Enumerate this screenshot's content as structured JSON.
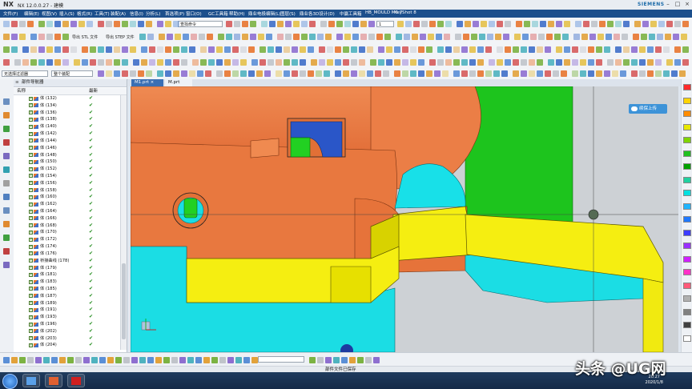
{
  "window": {
    "logo": "NX",
    "title": "NX 12.0.0.27 - 建模",
    "brand": "SIEMENS"
  },
  "menu": [
    "文件(F)",
    "编辑(E)",
    "视图(V)",
    "插入(S)",
    "格式(R)",
    "工具(T)",
    "装配(A)",
    "信息(I)",
    "分析(L)",
    "首选项(P)",
    "窗口(O)",
    "GC工具箱",
    "帮助(H)",
    "鼎业电极编辑(L)",
    "图层(S)",
    "鼎业各3D设计(D)",
    "中赢工具箱",
    "HB_MOULD M6.7",
    "KeyShot 8"
  ],
  "toolbar": {
    "command_search": "查找命令",
    "count_value": "1",
    "export_stl": "导出 STL 文件",
    "export_step": "导出 STEP 文件",
    "filter_label": "无选择过滤器",
    "assembly_scope": "整个装配"
  },
  "navigator": {
    "title": "部件导航器",
    "col_name": "名称",
    "col_latest": "最新",
    "rows": [
      "体 (132)",
      "体 (134)",
      "体 (136)",
      "体 (138)",
      "体 (140)",
      "体 (142)",
      "体 (144)",
      "体 (146)",
      "体 (148)",
      "体 (150)",
      "体 (152)",
      "体 (154)",
      "体 (156)",
      "体 (158)",
      "体 (160)",
      "体 (162)",
      "体 (164)",
      "体 (166)",
      "体 (168)",
      "体 (170)",
      "体 (172)",
      "体 (174)",
      "体 (176)",
      "桥接曲线 (178)",
      "体 (179)",
      "体 (181)",
      "体 (183)",
      "体 (185)",
      "体 (187)",
      "体 (189)",
      "体 (191)",
      "体 (193)",
      "体 (196)",
      "体 (202)",
      "体 (203)",
      "体 (204)"
    ],
    "latest_mark": "✔"
  },
  "tabs": [
    {
      "label": "M1.prt",
      "active": true
    },
    {
      "label": "M.prt",
      "active": false
    }
  ],
  "viewport": {
    "upload_label": "续保上传"
  },
  "palette": [
    "#ff2a2a",
    "#ffd400",
    "#ff8c00",
    "#e8e800",
    "#7fd400",
    "#20c020",
    "#00a000",
    "#20d0a0",
    "#00e0e0",
    "#20b4ff",
    "#1e78ff",
    "#3c3cff",
    "#9a30ff",
    "#d020ff",
    "#ff30c8",
    "#ff5a7a",
    "#b0b0b0",
    "#808080",
    "#404040",
    "#ffffff"
  ],
  "status": {
    "message": "部件文件已保存"
  },
  "taskbar": {
    "time": "20:27",
    "date": "2020/1/8"
  },
  "watermark": "头条 @UG网"
}
